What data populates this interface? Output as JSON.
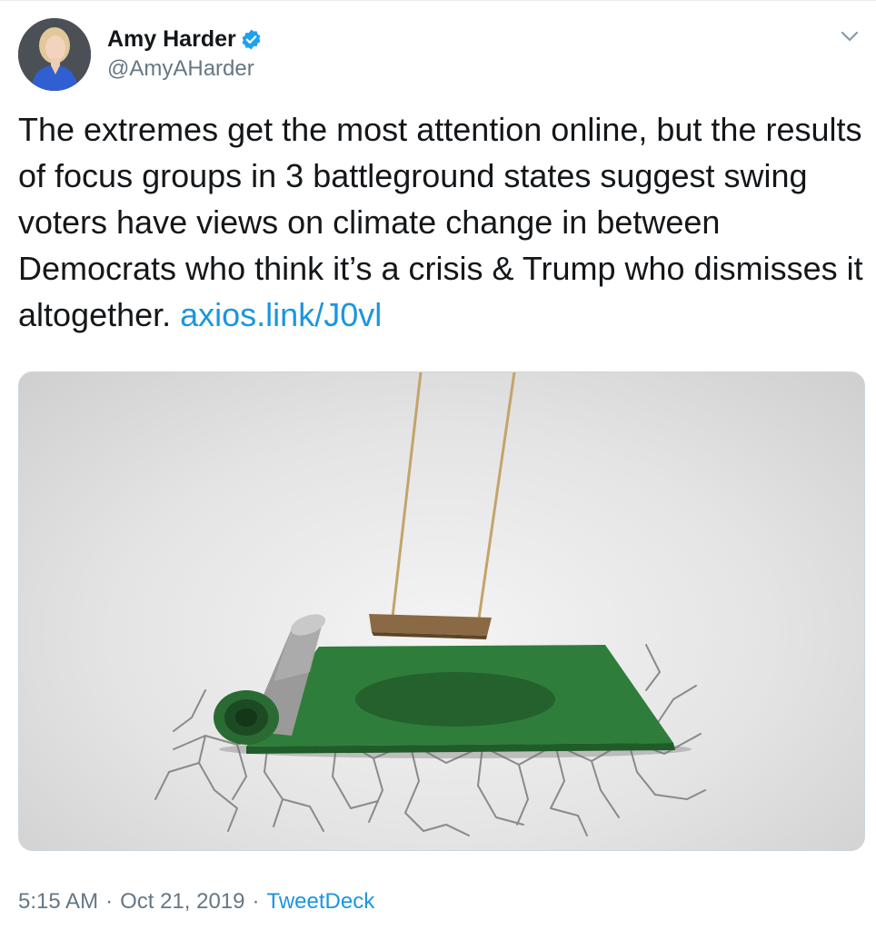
{
  "author": {
    "name": "Amy Harder",
    "handle": "@AmyAHarder",
    "verified": true,
    "avatar_icon": "profile-photo"
  },
  "tweet": {
    "text": "The extremes get the most attention online, but the results of focus groups in 3 battleground states suggest swing voters have views on climate change in between Democrats who think it’s a crisis & Trump who dismisses it altogether. ",
    "link_text": "axios.link/J0vl"
  },
  "media": {
    "alt_icon": "illustration-swing-over-rolled-green-carpet-on-cracked-ground"
  },
  "meta": {
    "time": "5:15 AM",
    "separator1": "·",
    "date": "Oct 21, 2019",
    "separator2": "·",
    "source": "TweetDeck"
  },
  "colors": {
    "link": "#1b95e0",
    "secondary_text": "#657786",
    "verified": "#1da1f2",
    "carpet": "#2f7d3a"
  }
}
